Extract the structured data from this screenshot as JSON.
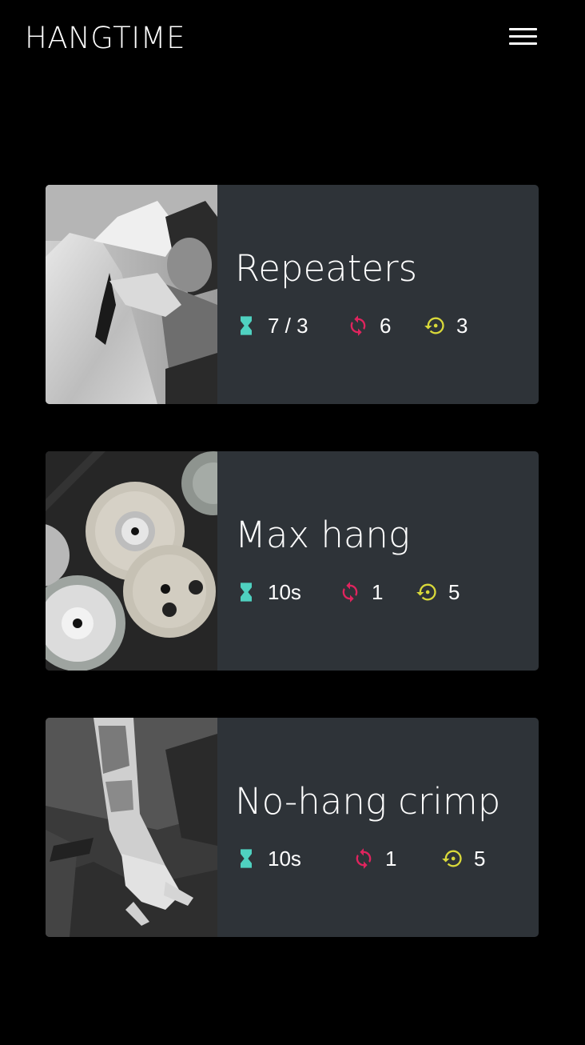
{
  "app": {
    "title": "HANGTIME",
    "menu_icon": "hamburger-menu-icon"
  },
  "colors": {
    "background": "#000000",
    "card": "#2e3338",
    "hang_icon": "#4fd1c0",
    "reps_icon": "#e0245e",
    "rest_icon": "#d9d93a"
  },
  "workouts": [
    {
      "title": "Repeaters",
      "image": "climber-on-rock-photo",
      "hang": "7 / 3",
      "reps": "6",
      "sets": "3"
    },
    {
      "title": "Max hang",
      "image": "weight-plates-photo",
      "hang": "10s",
      "reps": "1",
      "sets": "5"
    },
    {
      "title": "No-hang crimp",
      "image": "tattooed-hand-crimp-photo",
      "hang": "10s",
      "reps": "1",
      "sets": "5"
    }
  ]
}
